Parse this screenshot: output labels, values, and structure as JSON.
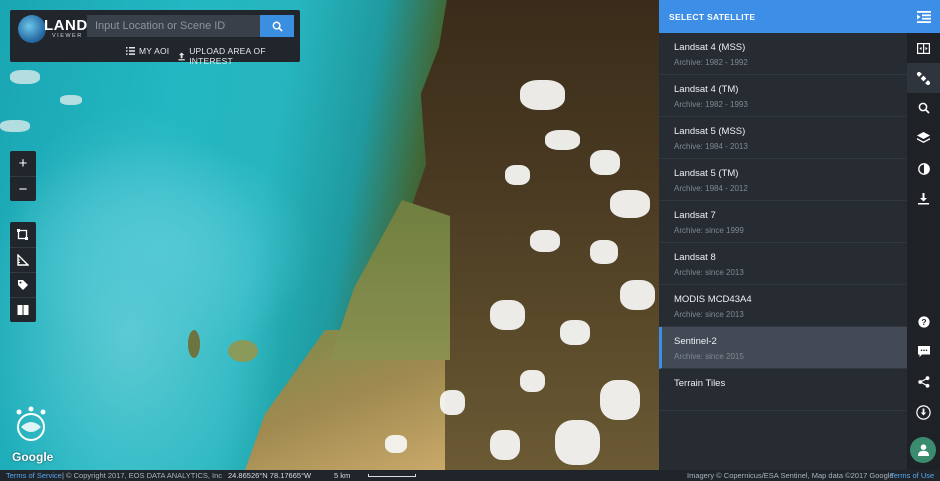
{
  "logo": {
    "title": "LAND",
    "subtitle": "VIEWER"
  },
  "search": {
    "placeholder": "Input Location or Scene ID"
  },
  "links": {
    "my_aoi": "MY AOI",
    "upload_aoi": "UPLOAD AREA OF INTEREST"
  },
  "map": {
    "zoom_in": "+",
    "zoom_out": "−",
    "provider": "Google"
  },
  "satellite_panel": {
    "header": "SELECT SATELLITE",
    "items": [
      {
        "name": "Landsat 4 (MSS)",
        "archive": "Archive: 1982 - 1992",
        "selected": false
      },
      {
        "name": "Landsat 4 (TM)",
        "archive": "Archive: 1982 - 1993",
        "selected": false
      },
      {
        "name": "Landsat 5 (MSS)",
        "archive": "Archive: 1984 - 2013",
        "selected": false
      },
      {
        "name": "Landsat 5 (TM)",
        "archive": "Archive: 1984 - 2012",
        "selected": false
      },
      {
        "name": "Landsat 7",
        "archive": "Archive: since 1999",
        "selected": false
      },
      {
        "name": "Landsat 8",
        "archive": "Archive: since 2013",
        "selected": false
      },
      {
        "name": "MODIS MCD43A4",
        "archive": "Archive: since 2013",
        "selected": false
      },
      {
        "name": "Sentinel-2",
        "archive": "Archive: since 2015",
        "selected": true
      },
      {
        "name": "Terrain Tiles",
        "archive": "",
        "selected": false
      }
    ]
  },
  "status_bar": {
    "terms_left": "Terms of Service",
    "copyright": "| © Copyright 2017, EOS DATA ANALYTICS, Inc",
    "coordinates": "24.86526°N 78.17665°W",
    "scale": "5 km",
    "imagery": "Imagery © Copernicus/ESA Sentinel, Map data ©2017 Google",
    "terms_right": "Terms of Use"
  },
  "colors": {
    "accent": "#3c8ee6",
    "panel_bg": "#272c33",
    "avatar": "#3b8c6e"
  }
}
